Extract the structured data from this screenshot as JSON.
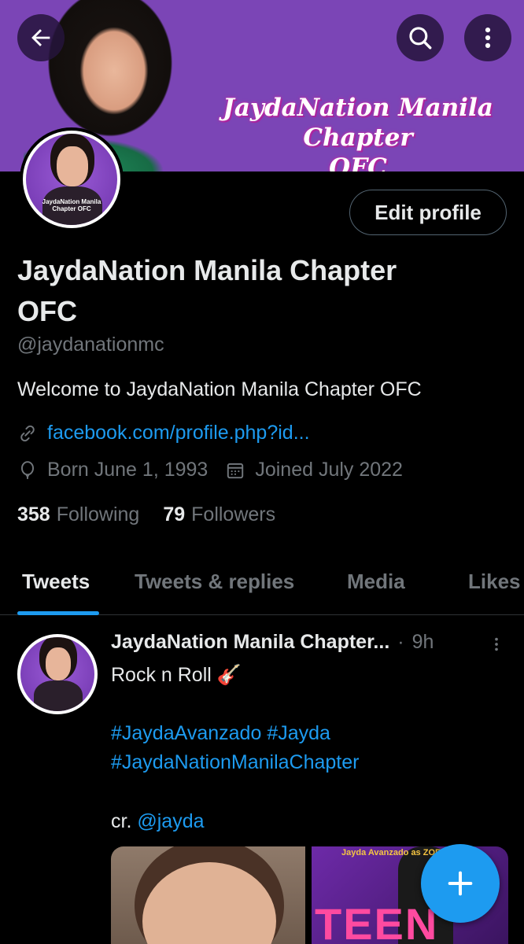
{
  "banner": {
    "title_line1": "JaydaNation Manila Chapter",
    "title_line2": "OFC",
    "background_color": "#7b45b6"
  },
  "top_bar": {
    "back_icon": "arrow-left-icon",
    "search_icon": "search-icon",
    "more_icon": "more-vertical-icon"
  },
  "profile": {
    "edit_button_label": "Edit profile",
    "name_line1": "JaydaNation Manila Chapter",
    "name_line2": "OFC",
    "handle": "@jaydanationmc",
    "bio": "Welcome to JaydaNation Manila Chapter OFC",
    "link": "facebook.com/profile.php?id...",
    "birthday": "Born June 1, 1993",
    "joined": "Joined July 2022",
    "avatar_caption": "JaydaNation Manila Chapter OFC"
  },
  "stats": {
    "following_count": "358",
    "following_label": "Following",
    "followers_count": "79",
    "followers_label": "Followers"
  },
  "tabs": [
    {
      "label": "Tweets",
      "active": true
    },
    {
      "label": "Tweets & replies",
      "active": false
    },
    {
      "label": "Media",
      "active": false
    },
    {
      "label": "Likes",
      "active": false
    }
  ],
  "tweet": {
    "author": "JaydaNation Manila Chapter...",
    "separator": "·",
    "time": "9h",
    "text_line1": "Rock n Roll 🎸",
    "hashtag1": "#JaydaAvanzado",
    "hashtag2": "#Jayda",
    "hashtag3": "#JaydaNationManilaChapter",
    "credit_prefix": "cr.",
    "credit_mention": "@jayda",
    "media_right_caption": "Jayda Avanzado as ZOE",
    "media_right_text": "TEEN"
  },
  "colors": {
    "accent": "#1d9bf0",
    "muted": "#71767b",
    "text": "#e7e9ea",
    "background": "#000000"
  }
}
